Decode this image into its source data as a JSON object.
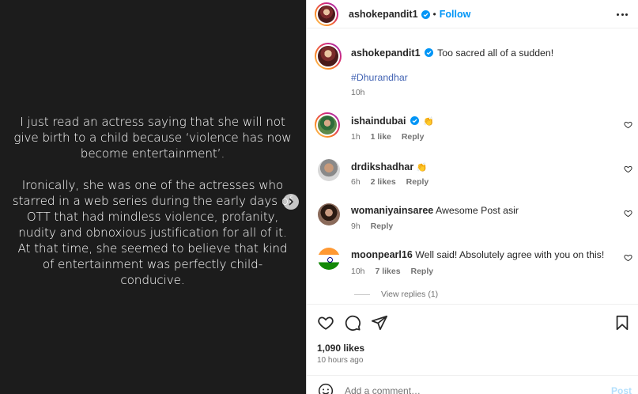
{
  "media": {
    "paragraphs": [
      "I just read an actress saying that she will not give birth to a child because ‘violence has now become entertainment’.",
      "Ironically, she was one of the actresses who starred in a web series during the early days of OTT that had mindless violence, profanity, nudity and obnoxious justification for all of it. At that time, she seemed to believe that kind of entertainment was perfectly child-conducive."
    ]
  },
  "header": {
    "username": "ashokepandit1",
    "separator": "•",
    "follow_label": "Follow"
  },
  "caption": {
    "username": "ashokepandit1",
    "text": "Too sacred all of a sudden!",
    "hashtag": "#Dhurandhar",
    "time": "10h"
  },
  "comments": [
    {
      "username": "ishaindubai",
      "text": "",
      "emoji": "👏",
      "time": "1h",
      "likes": "1 like",
      "reply": "Reply"
    },
    {
      "username": "drdikshadhar",
      "text": "",
      "emoji": "👏",
      "time": "6h",
      "likes": "2 likes",
      "reply": "Reply"
    },
    {
      "username": "womaniyainsaree",
      "text": "Awesome Post asir",
      "emoji": "",
      "time": "9h",
      "likes": "",
      "reply": "Reply"
    },
    {
      "username": "moonpearl16",
      "text": "Well said! Absolutely agree with you on this!",
      "emoji": "",
      "time": "10h",
      "likes": "7 likes",
      "reply": "Reply"
    }
  ],
  "view_replies": "View replies (1)",
  "likes": "1,090 likes",
  "posted": "10 hours ago",
  "add_comment": {
    "placeholder": "Add a comment…",
    "post_label": "Post"
  },
  "icons": {
    "next": "chevron-right-icon",
    "more": "more-options-icon",
    "verified": "verified-badge-icon",
    "like": "heart-icon",
    "comment": "comment-icon",
    "share": "share-icon",
    "save": "bookmark-icon",
    "emoji": "emoji-icon"
  },
  "colors": {
    "accent": "#0095f6",
    "verified": "#0095f6",
    "hashtag": "#4263b3",
    "media_bg": "#1c1c1c"
  }
}
